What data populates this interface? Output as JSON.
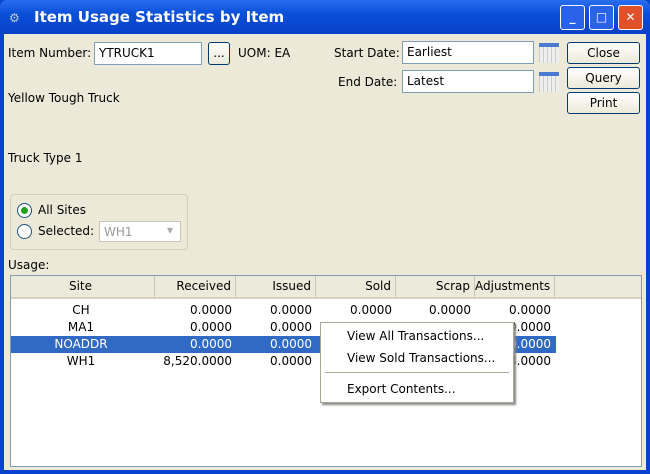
{
  "window": {
    "title": "Item Usage Statistics by Item",
    "min": "_",
    "max": "□",
    "close": "✕"
  },
  "form": {
    "item_label": "Item Number:",
    "item_value": "YTRUCK1",
    "lookup": "...",
    "uom": "UOM: EA",
    "description1": "Yellow Tough Truck",
    "description2": "Truck Type 1",
    "start_label": "Start Date:",
    "start_value": "Earliest",
    "end_label": "End Date:",
    "end_value": "Latest"
  },
  "buttons": {
    "close": "Close",
    "query": "Query",
    "print": "Print"
  },
  "sites": {
    "all": "All Sites",
    "selected": "Selected:",
    "selected_value": "WH1",
    "mode": "all"
  },
  "usage": {
    "label": "Usage:",
    "columns": [
      "Site",
      "Received",
      "Issued",
      "Sold",
      "Scrap",
      "Adjustments"
    ],
    "rows": [
      [
        "CH",
        "0.0000",
        "0.0000",
        "0.0000",
        "0.0000",
        "0.0000"
      ],
      [
        "MA1",
        "0.0000",
        "0.0000",
        "",
        "",
        "0.0000"
      ],
      [
        "NOADDR",
        "0.0000",
        "0.0000",
        "",
        "",
        "0.0000"
      ],
      [
        "WH1",
        "8,520.0000",
        "0.0000",
        "",
        "",
        "8.0000"
      ]
    ],
    "selected_row": 2
  },
  "context_menu": {
    "items": [
      "View All Transactions...",
      "View Sold Transactions...",
      "Export Contents..."
    ]
  }
}
